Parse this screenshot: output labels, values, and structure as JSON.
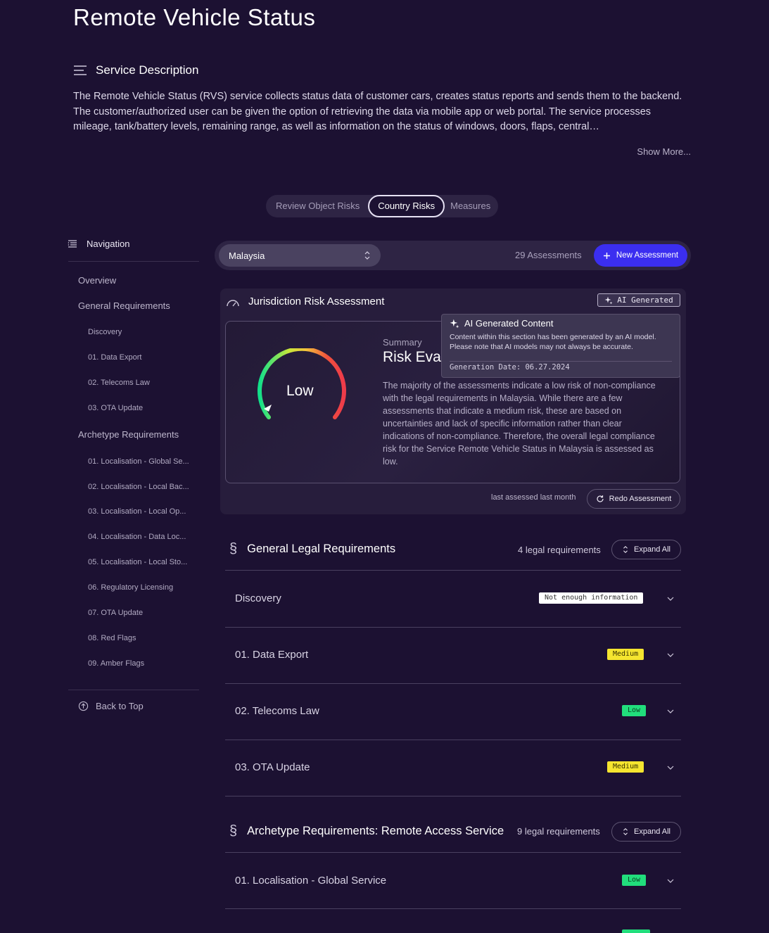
{
  "page": {
    "title": "Remote Vehicle Status"
  },
  "service_description": {
    "heading": "Service Description",
    "text": "The Remote Vehicle Status (RVS) service collects status data of customer cars, creates status reports and sends them to the backend. The customer/authorized user can be given the option of retrieving the data via mobile app or web portal. The service processes mileage, tank/battery levels, remaining range, as well as information on the status of windows, doors, flaps, central…",
    "show_more": "Show More..."
  },
  "tabs": [
    {
      "label": "Review Object Risks",
      "active": false
    },
    {
      "label": "Country Risks",
      "active": true
    },
    {
      "label": "Measures",
      "active": false
    }
  ],
  "navigation": {
    "heading": "Navigation",
    "overview": "Overview",
    "general": {
      "label": "General Requirements",
      "items": [
        "Discovery",
        "01. Data Export",
        "02. Telecoms Law",
        "03. OTA Update"
      ]
    },
    "archetype": {
      "label": "Archetype Requirements",
      "items": [
        "01. Localisation - Global Se...",
        "02. Localisation - Local Bac...",
        "03. Localisation - Local Op...",
        "04. Localisation - Data Loc...",
        "05. Localisation - Local Sto...",
        "06. Regulatory Licensing",
        "07. OTA Update",
        "08. Red Flags",
        "09. Amber Flags"
      ]
    },
    "back_to_top": "Back to Top"
  },
  "country_bar": {
    "selected_country": "Malaysia",
    "assessments": "29 Assessments",
    "new_assessment": "New Assessment"
  },
  "jurisdiction": {
    "title": "Jurisdiction Risk Assessment",
    "ai_badge": "AI Generated",
    "gauge_label": "Low",
    "summary_label": "Summary",
    "summary_title": "Risk Evaluation",
    "summary_text": "The majority of the assessments indicate a low risk of non-compliance with the legal requirements in Malaysia. While there are a few assessments that indicate a medium risk, these are based on uncertainties and lack of specific information rather than clear indications of non-compliance. Therefore, the overall legal compliance risk for the Service Remote Vehicle Status in Malaysia is assessed as low.",
    "tooltip": {
      "heading": "AI Generated Content",
      "body": "Content within this section has been generated by an AI model. Please note that AI models may not always be accurate.",
      "date": "Generation Date: 06.27.2024"
    },
    "last_assessed": "last assessed last month",
    "redo": "Redo Assessment"
  },
  "general_legal": {
    "symbol": "§",
    "title": "General Legal Requirements",
    "count": "4 legal requirements",
    "expand": "Expand All",
    "rows": [
      {
        "name": "Discovery",
        "badge": "Not enough information"
      },
      {
        "name": "01. Data Export",
        "badge": "Medium"
      },
      {
        "name": "02. Telecoms Law",
        "badge": "Low"
      },
      {
        "name": "03. OTA Update",
        "badge": "Medium"
      }
    ]
  },
  "archetype_legal": {
    "symbol": "§",
    "title": "Archetype Requirements: Remote Access Service",
    "count": "9 legal requirements",
    "expand": "Expand All",
    "rows": [
      {
        "name": "01. Localisation - Global Service",
        "badge": "Low"
      }
    ]
  },
  "colors": {
    "background": "#1c1132",
    "accent": "#3b2ef0",
    "low": "#21de7c",
    "medium": "#f5e52f"
  }
}
